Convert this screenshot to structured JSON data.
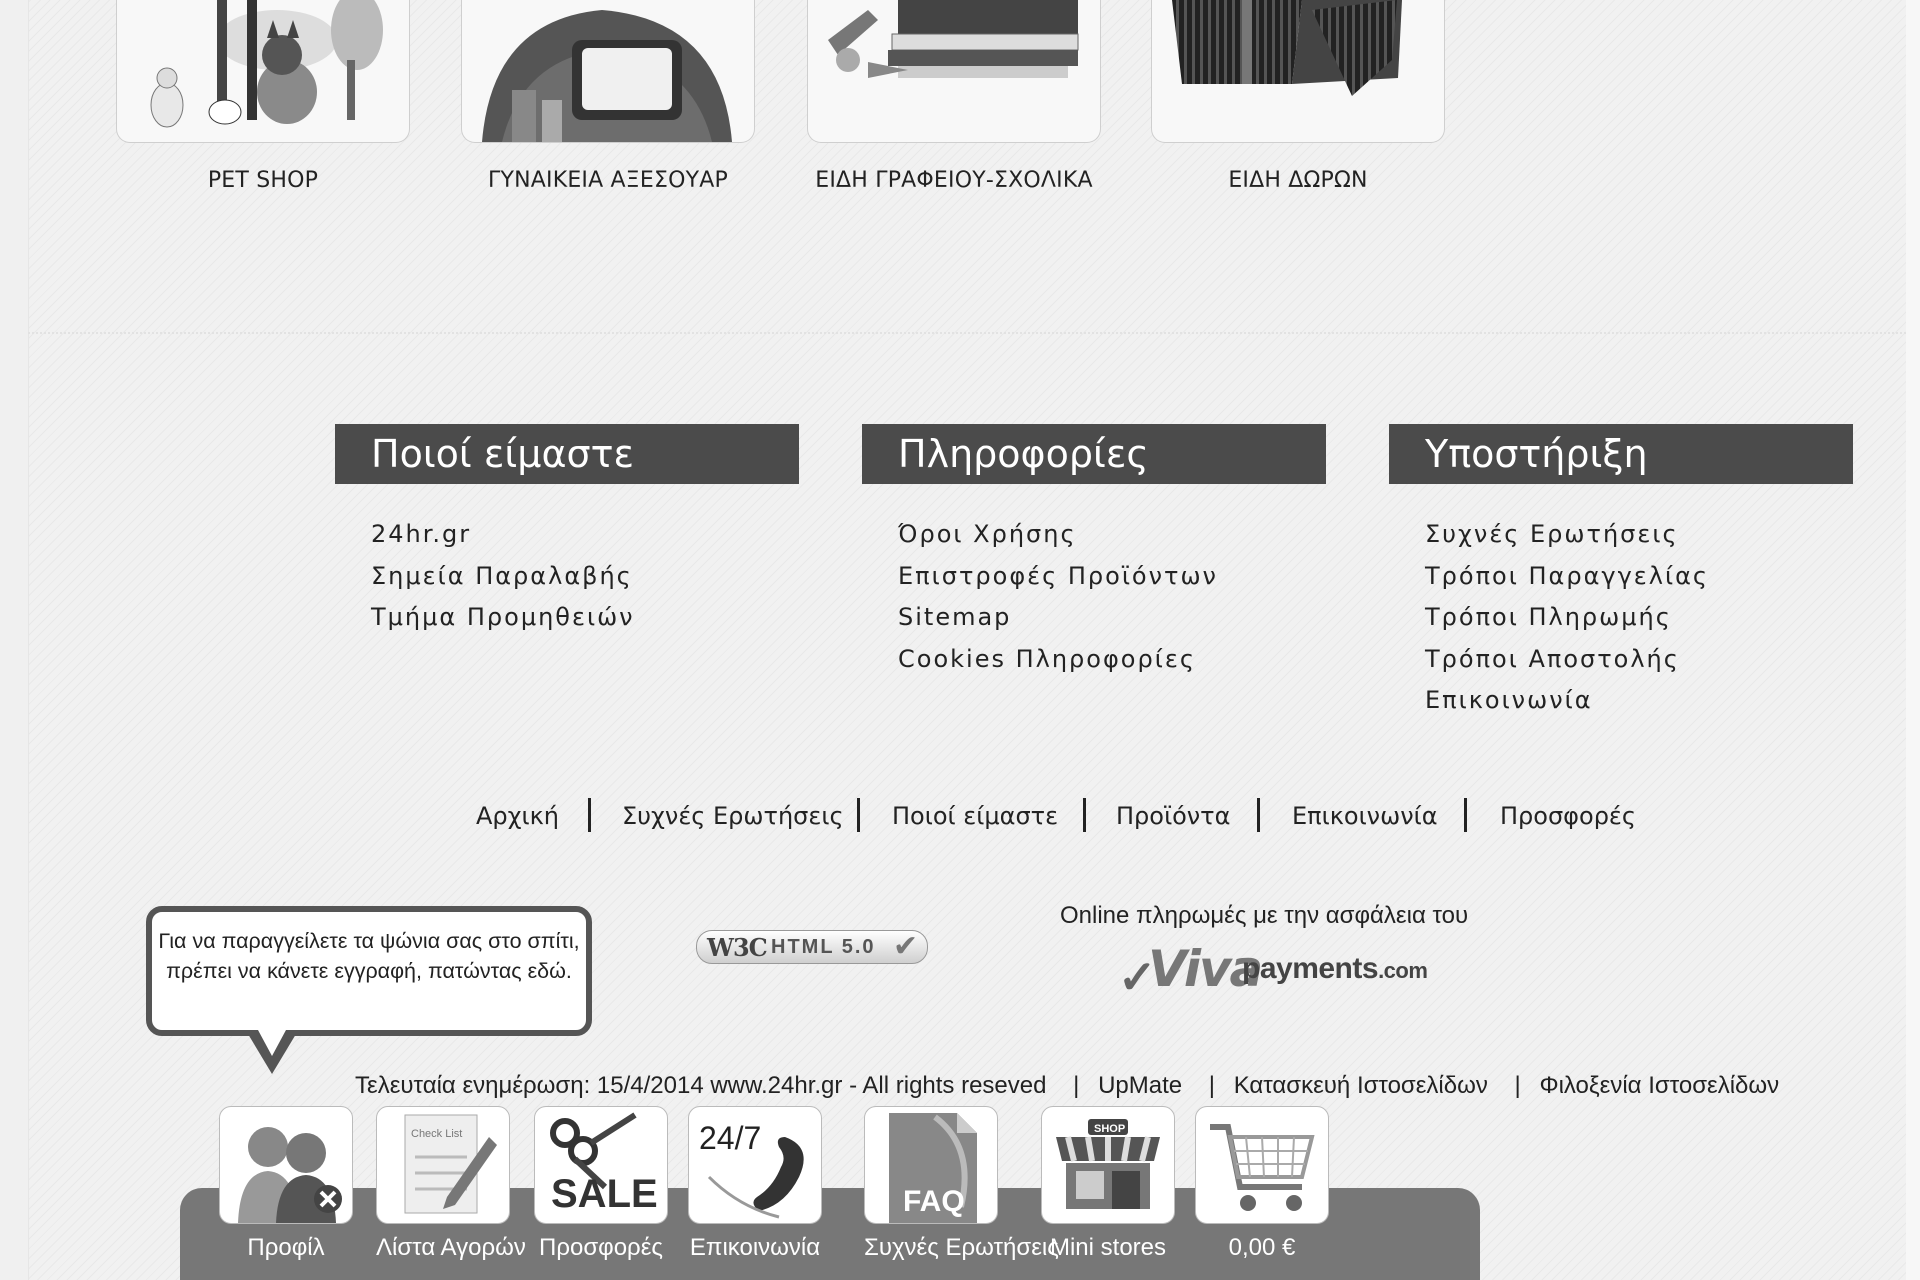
{
  "categories": [
    {
      "label": "PET SHOP"
    },
    {
      "label": "ΓΥΝΑΙΚΕΙΑ ΑΞΕΣΟΥΑΡ"
    },
    {
      "label": "ΕΙΔΗ ΓΡΑΦΕΙΟΥ-ΣΧΟΛΙΚΑ"
    },
    {
      "label": "ΕΙΔΗ ΔΩΡΩΝ"
    }
  ],
  "footer_columns": [
    {
      "title": "Ποιοί είμαστε",
      "links": [
        "24hr.gr",
        "Σημεία Παραλαβής",
        "Τμήμα Προμηθειών"
      ]
    },
    {
      "title": "Πληροφορίες",
      "links": [
        "Όροι Χρήσης",
        "Επιστροφές Προϊόντων",
        "Sitemap",
        "Cookies Πληροφορίες"
      ]
    },
    {
      "title": "Υποστήριξη",
      "links": [
        "Συχνές Ερωτήσεις",
        "Τρόποι Παραγγελίας",
        "Τρόποι Πληρωμής",
        "Τρόποι Αποστολής",
        "Επικοινωνία"
      ]
    }
  ],
  "bottom_nav": [
    "Αρχική",
    "Συχνές Ερωτήσεις",
    "Ποιοί είμαστε",
    "Προϊόντα",
    "Επικοινωνία",
    "Προσφορές"
  ],
  "tooltip": {
    "text": "Για να παραγγείλετε τα ψώνια σας στο σπίτι, πρέπει να κάνετε εγγραφή, πατώντας εδώ."
  },
  "w3c_badge": {
    "w3c": "W3C",
    "html": "HTML 5.0"
  },
  "payments": {
    "text": "Online πληρωμές με την ασφάλεια του",
    "logo_viva": "Viva",
    "logo_payments": "payments",
    "logo_domain": ".com"
  },
  "copyright": {
    "text": "Τελευταία ενημέρωση: 15/4/2014 www.24hr.gr - All rights reseved",
    "links": [
      "UpMate",
      "Κατασκευή Ιστοσελίδων",
      "Φιλοξενία Ιστοσελίδων"
    ]
  },
  "toolbar": [
    {
      "label": "Προφίλ",
      "icon": "profile-icon"
    },
    {
      "label": "Λίστα Αγορών",
      "icon": "checklist-icon",
      "icon_text": "Check List"
    },
    {
      "label": "Προσφορές",
      "icon": "sale-icon",
      "icon_text": "SALE"
    },
    {
      "label": "Επικοινωνία",
      "icon": "phone-24-7-icon",
      "icon_text": "24/7"
    },
    {
      "label": "Συχνές Ερωτήσεις",
      "icon": "faq-icon",
      "icon_text": "FAQ"
    },
    {
      "label": "Mini stores",
      "icon": "shop-icon",
      "icon_text": "SHOP"
    },
    {
      "label": "0,00 €",
      "icon": "cart-icon"
    }
  ]
}
